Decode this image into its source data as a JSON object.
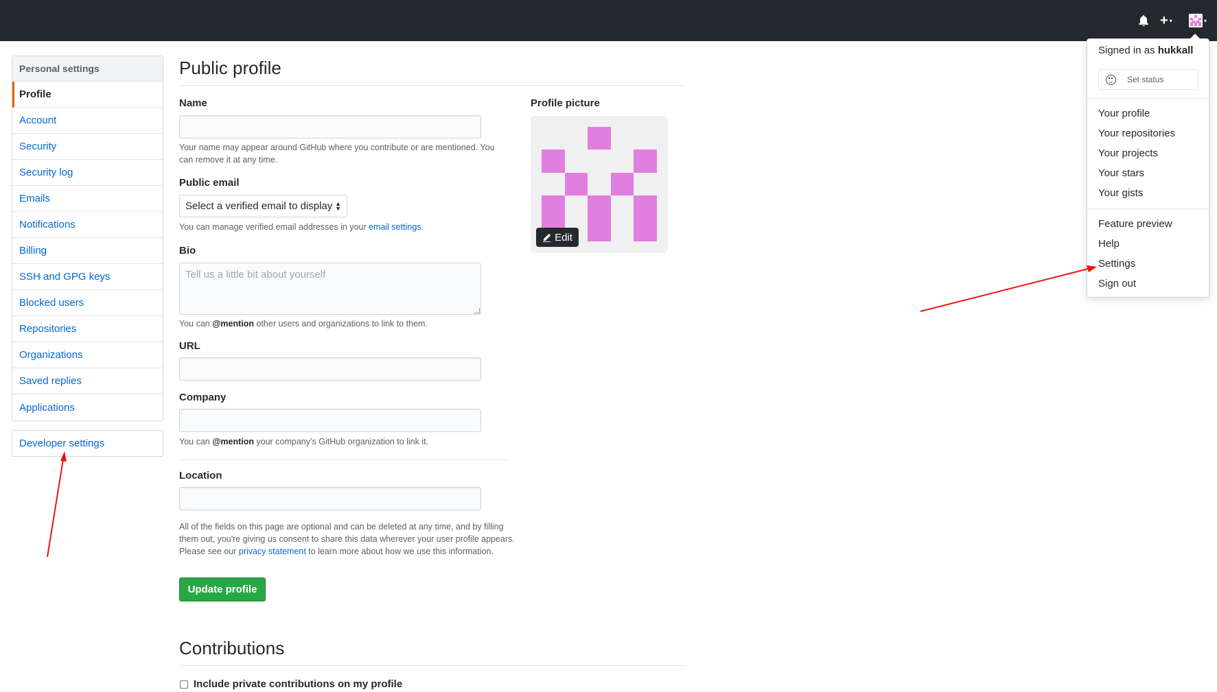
{
  "header": {
    "bell_icon": "bell-icon",
    "plus_label": "+",
    "caret": "▾"
  },
  "sidebar": {
    "heading": "Personal settings",
    "items": [
      {
        "label": "Profile",
        "selected": true
      },
      {
        "label": "Account"
      },
      {
        "label": "Security"
      },
      {
        "label": "Security log"
      },
      {
        "label": "Emails"
      },
      {
        "label": "Notifications"
      },
      {
        "label": "Billing"
      },
      {
        "label": "SSH and GPG keys"
      },
      {
        "label": "Blocked users"
      },
      {
        "label": "Repositories"
      },
      {
        "label": "Organizations"
      },
      {
        "label": "Saved replies"
      },
      {
        "label": "Applications"
      }
    ],
    "developer_settings": "Developer settings"
  },
  "main": {
    "title": "Public profile",
    "name": {
      "label": "Name",
      "value": "",
      "note": "Your name may appear around GitHub where you contribute or are mentioned. You can remove it at any time."
    },
    "public_email": {
      "label": "Public email",
      "selected": "Select a verified email to display",
      "note_prefix": "You can manage verified email addresses in your ",
      "note_link": "email settings",
      "note_suffix": "."
    },
    "bio": {
      "label": "Bio",
      "placeholder": "Tell us a little bit about yourself",
      "note_prefix": "You can ",
      "note_mention": "@mention",
      "note_suffix": " other users and organizations to link to them."
    },
    "url": {
      "label": "URL",
      "value": ""
    },
    "company": {
      "label": "Company",
      "value": "",
      "note_prefix": "You can ",
      "note_mention": "@mention",
      "note_suffix": " your company’s GitHub organization to link it."
    },
    "location": {
      "label": "Location",
      "value": ""
    },
    "disclaimer_prefix": "All of the fields on this page are optional and can be deleted at any time, and by filling them out, you're giving us consent to share this data wherever your user profile appears. Please see our ",
    "disclaimer_link": "privacy statement",
    "disclaimer_suffix": " to learn more about how we use this information.",
    "update_button": "Update profile",
    "contributions_title": "Contributions",
    "private_contributions_label": "Include private contributions on my profile"
  },
  "profile_picture": {
    "label": "Profile picture",
    "edit_label": "Edit",
    "accent": "#e07fdf"
  },
  "dropdown": {
    "signed_in_prefix": "Signed in as ",
    "username": "hukkall",
    "set_status": "Set status",
    "group1": [
      "Your profile",
      "Your repositories",
      "Your projects",
      "Your stars",
      "Your gists"
    ],
    "group2": [
      "Feature preview",
      "Help",
      "Settings",
      "Sign out"
    ]
  },
  "colors": {
    "header_bg": "#24292e",
    "link": "#0366d6",
    "primary_button": "#28a745",
    "annotation": "#ee1111"
  }
}
